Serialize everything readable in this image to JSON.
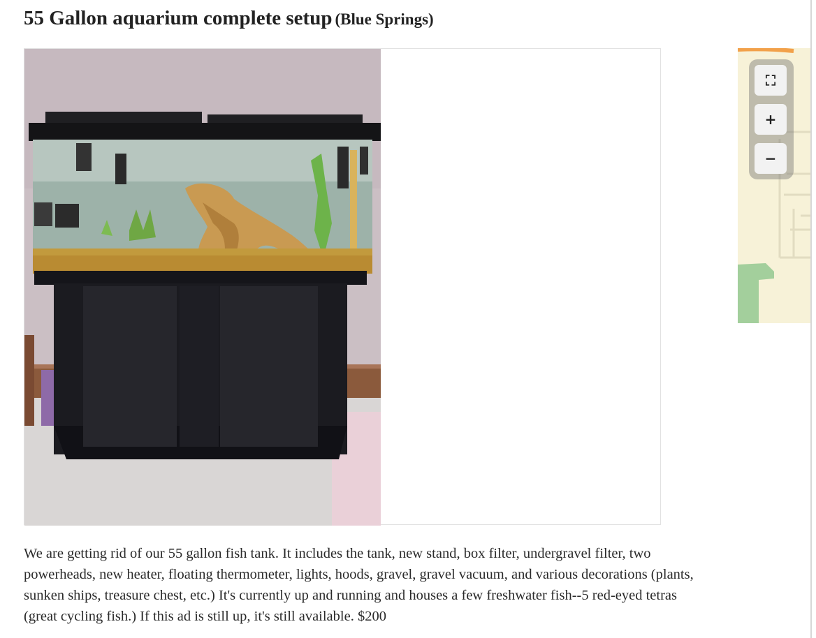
{
  "posting": {
    "title": "55 Gallon aquarium complete setup",
    "location": "(Blue Springs)",
    "body_lines": [
      "We are getting rid of our 55 gallon fish tank. It includes the tank, new stand, box filter, undergravel filter, two",
      "powerheads, new heater, floating thermometer, lights, hoods, gravel, gravel vacuum, and various decorations (plants,",
      "sunken ships, treasure chest, etc.) It's currently up and running and houses a few freshwater fish--5 red-eyed tetras",
      "(great cycling fish.) If this ad is still up, it's still available. $200"
    ]
  },
  "map": {
    "fullscreen_icon": "fullscreen-icon",
    "zoom_in_label": "+",
    "zoom_out_label": "−"
  },
  "colors": {
    "text": "#222222",
    "map_land": "#f7f2d8",
    "map_park": "#a3cf9c"
  }
}
